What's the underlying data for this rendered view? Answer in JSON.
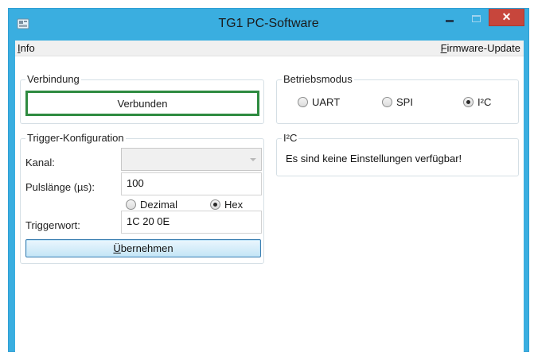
{
  "window": {
    "title": "TG1 PC-Software",
    "close_glyph": "✕"
  },
  "menu": {
    "info_mnemonic": "I",
    "info_rest": "nfo",
    "firmware_mnemonic": "F",
    "firmware_rest": "irmware-Update"
  },
  "verbindung": {
    "label": "Verbindung",
    "status": "Verbunden",
    "status_color": "#2e8b40"
  },
  "betriebsmodus": {
    "label": "Betriebsmodus",
    "options": [
      {
        "label": "UART",
        "checked": false
      },
      {
        "label": "SPI",
        "checked": false
      },
      {
        "label": "I²C",
        "checked": true
      }
    ]
  },
  "trigger": {
    "label": "Trigger-Konfiguration",
    "kanal_label": "Kanal:",
    "kanal_value": "",
    "puls_label": "Pulslänge (µs):",
    "puls_value": "100",
    "format_options": [
      {
        "label": "Dezimal",
        "checked": false
      },
      {
        "label": "Hex",
        "checked": true
      }
    ],
    "triggerwort_label": "Triggerwort:",
    "triggerwort_value": "1C 20 0E",
    "apply_mnemonic": "Ü",
    "apply_rest": "bernehmen"
  },
  "i2c": {
    "label": "I²C",
    "message": "Es sind keine Einstellungen verfügbar!"
  },
  "colors": {
    "titlebar": "#3aaee0",
    "close_button": "#c7463c"
  },
  "icons": [
    "app-icon",
    "minimize-icon",
    "maximize-icon",
    "close-icon",
    "chevron-down-icon"
  ]
}
